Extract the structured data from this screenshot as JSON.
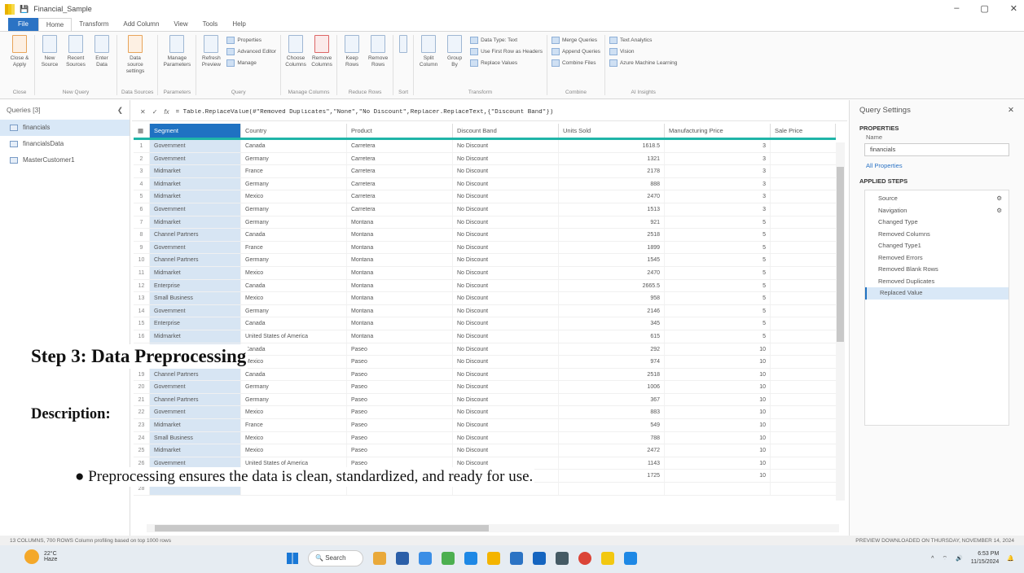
{
  "window": {
    "title": "Financial_Sample",
    "controls": [
      "–",
      "▢",
      "✕"
    ]
  },
  "ribbon_tabs": [
    "File",
    "Home",
    "Transform",
    "Add Column",
    "View",
    "Tools",
    "Help"
  ],
  "ribbon_groups": [
    {
      "label": "Close",
      "buttons": [
        "Close & Apply"
      ]
    },
    {
      "label": "New Query",
      "buttons": [
        "New Source",
        "Recent Sources",
        "Enter Data"
      ]
    },
    {
      "label": "Data Sources",
      "buttons": [
        "Data source settings"
      ]
    },
    {
      "label": "Parameters",
      "buttons": [
        "Manage Parameters"
      ]
    },
    {
      "label": "Query",
      "buttons": [
        "Refresh Preview"
      ],
      "small": [
        "Properties",
        "Advanced Editor",
        "Manage"
      ]
    },
    {
      "label": "Manage Columns",
      "buttons": [
        "Choose Columns",
        "Remove Columns"
      ]
    },
    {
      "label": "Reduce Rows",
      "buttons": [
        "Keep Rows",
        "Remove Rows"
      ]
    },
    {
      "label": "Sort",
      "buttons": [
        "Sort"
      ]
    },
    {
      "label": "Transform",
      "buttons": [
        "Split Column",
        "Group By"
      ],
      "small": [
        "Data Type: Text",
        "Use First Row as Headers",
        "Replace Values"
      ]
    },
    {
      "label": "Combine",
      "small": [
        "Merge Queries",
        "Append Queries",
        "Combine Files"
      ]
    },
    {
      "label": "AI Insights",
      "small": [
        "Text Analytics",
        "Vision",
        "Azure Machine Learning"
      ]
    }
  ],
  "queries": {
    "header": "Queries [3]",
    "items": [
      "financials",
      "financialsData",
      "MasterCustomer1"
    ],
    "selected": 0
  },
  "formula": {
    "fx": "fx",
    "text": "= Table.ReplaceValue(#\"Removed Duplicates\",\"None\",\"No Discount\",Replacer.ReplaceText,{\"Discount Band\"})"
  },
  "columns": [
    "Segment",
    "Country",
    "Product",
    "Discount Band",
    "Units Sold",
    "Manufacturing Price",
    "Sale Price"
  ],
  "rows": [
    [
      "1",
      "Government",
      "Canada",
      "Carretera",
      "No Discount",
      "1618.5",
      "3"
    ],
    [
      "2",
      "Government",
      "Germany",
      "Carretera",
      "No Discount",
      "1321",
      "3"
    ],
    [
      "3",
      "Midmarket",
      "France",
      "Carretera",
      "No Discount",
      "2178",
      "3"
    ],
    [
      "4",
      "Midmarket",
      "Germany",
      "Carretera",
      "No Discount",
      "888",
      "3"
    ],
    [
      "5",
      "Midmarket",
      "Mexico",
      "Carretera",
      "No Discount",
      "2470",
      "3"
    ],
    [
      "6",
      "Government",
      "Germany",
      "Carretera",
      "No Discount",
      "1513",
      "3"
    ],
    [
      "7",
      "Midmarket",
      "Germany",
      "Montana",
      "No Discount",
      "921",
      "5"
    ],
    [
      "8",
      "Channel Partners",
      "Canada",
      "Montana",
      "No Discount",
      "2518",
      "5"
    ],
    [
      "9",
      "Government",
      "France",
      "Montana",
      "No Discount",
      "1899",
      "5"
    ],
    [
      "10",
      "Channel Partners",
      "Germany",
      "Montana",
      "No Discount",
      "1545",
      "5"
    ],
    [
      "11",
      "Midmarket",
      "Mexico",
      "Montana",
      "No Discount",
      "2470",
      "5"
    ],
    [
      "12",
      "Enterprise",
      "Canada",
      "Montana",
      "No Discount",
      "2665.5",
      "5"
    ],
    [
      "13",
      "Small Business",
      "Mexico",
      "Montana",
      "No Discount",
      "958",
      "5"
    ],
    [
      "14",
      "Government",
      "Germany",
      "Montana",
      "No Discount",
      "2146",
      "5"
    ],
    [
      "15",
      "Enterprise",
      "Canada",
      "Montana",
      "No Discount",
      "345",
      "5"
    ],
    [
      "16",
      "Midmarket",
      "United States of America",
      "Montana",
      "No Discount",
      "615",
      "5"
    ],
    [
      "17",
      "Government",
      "Canada",
      "Paseo",
      "No Discount",
      "292",
      "10"
    ],
    [
      "18",
      "Midmarket",
      "Mexico",
      "Paseo",
      "No Discount",
      "974",
      "10"
    ],
    [
      "19",
      "Channel Partners",
      "Canada",
      "Paseo",
      "No Discount",
      "2518",
      "10"
    ],
    [
      "20",
      "Government",
      "Germany",
      "Paseo",
      "No Discount",
      "1006",
      "10"
    ],
    [
      "21",
      "Channel Partners",
      "Germany",
      "Paseo",
      "No Discount",
      "367",
      "10"
    ],
    [
      "22",
      "Government",
      "Mexico",
      "Paseo",
      "No Discount",
      "883",
      "10"
    ],
    [
      "23",
      "Midmarket",
      "France",
      "Paseo",
      "No Discount",
      "549",
      "10"
    ],
    [
      "24",
      "Small Business",
      "Mexico",
      "Paseo",
      "No Discount",
      "788",
      "10"
    ],
    [
      "25",
      "Midmarket",
      "Mexico",
      "Paseo",
      "No Discount",
      "2472",
      "10"
    ],
    [
      "26",
      "Government",
      "United States of America",
      "Paseo",
      "No Discount",
      "1143",
      "10"
    ],
    [
      "27",
      "Government",
      "Canada",
      "Paseo",
      "No Discount",
      "1725",
      "10"
    ],
    [
      "28",
      "",
      "",
      "",
      "",
      "",
      ""
    ]
  ],
  "settings": {
    "title": "Query Settings",
    "properties_label": "PROPERTIES",
    "name_label": "Name",
    "name_value": "financials",
    "all_properties": "All Properties",
    "applied_steps_label": "APPLIED STEPS",
    "steps": [
      "Source",
      "Navigation",
      "Changed Type",
      "Removed Columns",
      "Changed Type1",
      "Removed Errors",
      "Removed Blank Rows",
      "Removed Duplicates",
      "Replaced Value"
    ],
    "selected_step": 8
  },
  "status": {
    "left": "13 COLUMNS, 700 ROWS    Column profiling based on top 1000 rows",
    "right": "PREVIEW DOWNLOADED ON THURSDAY, NOVEMBER 14, 2024"
  },
  "taskbar": {
    "temp": "22°C",
    "condition": "Haze",
    "search": "Search",
    "time": "6:53 PM",
    "date": "11/15/2024"
  },
  "overlay": {
    "title": "Step 3: Data Preprocessing",
    "description_label": "Description:",
    "bullet": "Preprocessing ensures the data is clean, standardized, and ready for use."
  },
  "colors": {
    "file_tab": "#2b73c4",
    "header_accent": "#1fb5a8",
    "selection": "#d9e8f7",
    "segment_col": "#1f72c2"
  }
}
